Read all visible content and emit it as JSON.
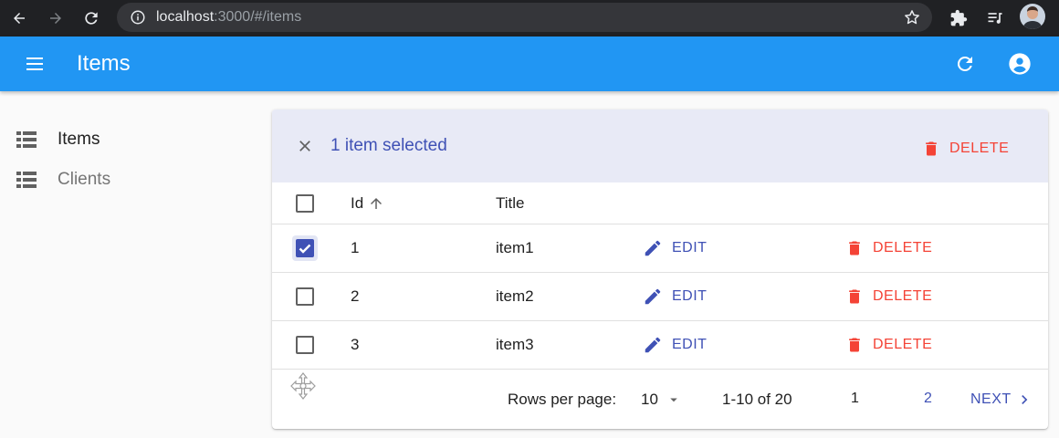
{
  "browser": {
    "url_host": "localhost",
    "url_rest": ":3000/#/items",
    "icons": [
      "back-icon",
      "forward-icon",
      "reload-icon",
      "info-icon",
      "star-icon",
      "puzzle-icon",
      "media-icon"
    ]
  },
  "appbar": {
    "title": "Items",
    "color": "#2196f3"
  },
  "sidebar": {
    "items": [
      {
        "label": "Items",
        "active": true
      },
      {
        "label": "Clients",
        "active": false
      }
    ]
  },
  "bulk": {
    "selected_text": "1 item selected",
    "delete_label": "DELETE"
  },
  "table": {
    "columns": [
      "Id",
      "Title"
    ],
    "sort": "Id ascending",
    "rows": [
      {
        "id": "1",
        "title": "item1",
        "edit": "EDIT",
        "delete": "DELETE",
        "selected": true
      },
      {
        "id": "2",
        "title": "item2",
        "edit": "EDIT",
        "delete": "DELETE",
        "selected": false
      },
      {
        "id": "3",
        "title": "item3",
        "edit": "EDIT",
        "delete": "DELETE",
        "selected": false
      }
    ]
  },
  "pagination": {
    "rows_per_page_label": "Rows per page:",
    "rows_per_page": "10",
    "range": "1-10 of 20",
    "pages": [
      "1",
      "2"
    ],
    "current_page": "1",
    "next_label": "NEXT"
  },
  "colors": {
    "primary": "#3f51b5",
    "danger": "#f44336",
    "selection_bg": "#e8eaf6"
  }
}
